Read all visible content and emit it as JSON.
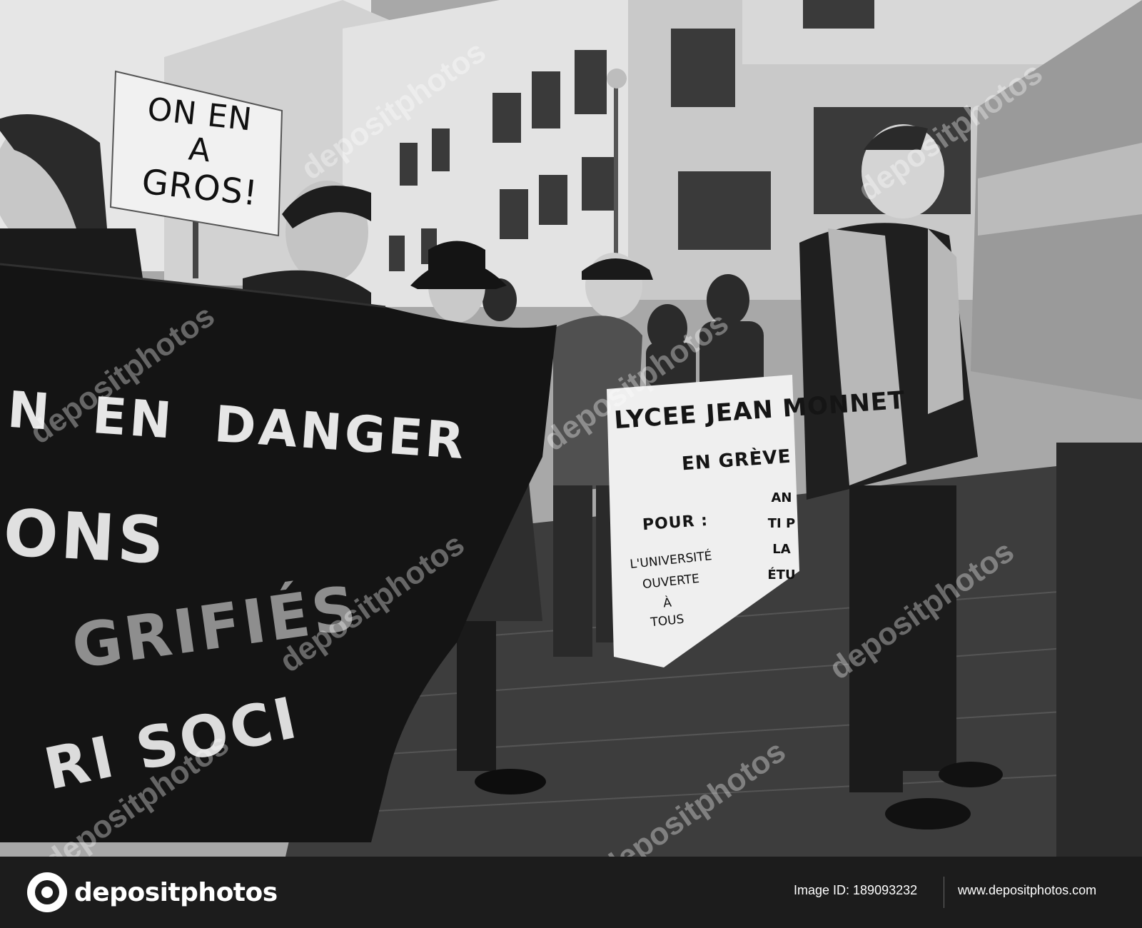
{
  "photo": {
    "sign": {
      "line1": "ON EN",
      "line2": "A",
      "line3": "GROS!"
    },
    "black_banner": {
      "line1": "N  EN  DANGER",
      "line2": "ONS",
      "line3": "GRIFIÉS",
      "line4": "RI SOCI"
    },
    "white_banner": {
      "title": "LYCEE JEAN MONNET",
      "subtitle": "EN GRÈVE",
      "pour": "POUR :",
      "l1": "L'UNIVERSITÉ",
      "l2": "OUVERTE",
      "l3": "À",
      "l4": "TOUS",
      "side": "ANTI PLA ÉTU"
    },
    "watermark": "depositphotos"
  },
  "footer": {
    "logo_text": "depositphotos",
    "image_id": "Image ID: 189093232",
    "site": "www.depositphotos.com"
  },
  "colors": {
    "footer_bg": "#1c1c1c",
    "photo_tone": "grayscale"
  }
}
